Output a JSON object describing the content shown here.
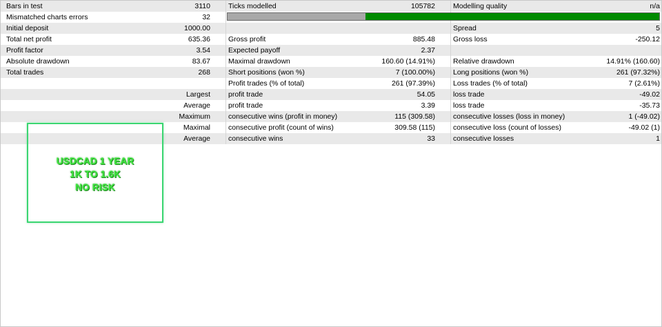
{
  "report": {
    "rows": [
      {
        "shade": true,
        "cells": [
          "Bars in test",
          "",
          "3110",
          "Ticks modelled",
          "105782",
          "Modelling quality",
          "n/a"
        ]
      },
      {
        "shade": false,
        "cells": [
          "Mismatched charts errors",
          "",
          "32",
          "",
          "",
          "",
          ""
        ]
      },
      {
        "shade": true,
        "cells": [
          "Initial deposit",
          "",
          "1000.00",
          "",
          "",
          "Spread",
          "5"
        ]
      },
      {
        "shade": false,
        "cells": [
          "Total net profit",
          "",
          "635.36",
          "Gross profit",
          "885.48",
          "Gross loss",
          "-250.12"
        ]
      },
      {
        "shade": true,
        "cells": [
          "Profit factor",
          "",
          "3.54",
          "Expected payoff",
          "2.37",
          "",
          ""
        ]
      },
      {
        "shade": false,
        "cells": [
          "Absolute drawdown",
          "",
          "83.67",
          "Maximal drawdown",
          "160.60 (14.91%)",
          "Relative drawdown",
          "14.91% (160.60)"
        ]
      },
      {
        "shade": true,
        "cells": [
          "Total trades",
          "",
          "268",
          "Short positions (won %)",
          "7 (100.00%)",
          "Long positions (won %)",
          "261 (97.32%)"
        ]
      },
      {
        "shade": false,
        "cells": [
          "",
          "",
          "",
          "Profit trades (% of total)",
          "261 (97.39%)",
          "Loss trades (% of total)",
          "7 (2.61%)"
        ]
      },
      {
        "shade": true,
        "cells": [
          "",
          "Largest",
          "",
          "profit trade",
          "54.05",
          "loss trade",
          "-49.02"
        ]
      },
      {
        "shade": false,
        "cells": [
          "",
          "Average",
          "",
          "profit trade",
          "3.39",
          "loss trade",
          "-35.73"
        ]
      },
      {
        "shade": true,
        "cells": [
          "",
          "Maximum",
          "",
          "consecutive wins (profit in money)",
          "115 (309.58)",
          "consecutive losses (loss in money)",
          "1 (-49.02)"
        ]
      },
      {
        "shade": false,
        "cells": [
          "",
          "Maximal",
          "",
          "consecutive profit (count of wins)",
          "309.58 (115)",
          "consecutive loss (count of losses)",
          "-49.02 (1)"
        ]
      },
      {
        "shade": true,
        "cells": [
          "",
          "Average",
          "",
          "consecutive wins",
          "33",
          "consecutive losses",
          "1"
        ]
      }
    ],
    "quality_bar": {
      "grey_fraction": 0.32,
      "grey_color": "#a8a8a8",
      "green_color": "#008a00"
    }
  },
  "note": {
    "lines": [
      "USDCAD 1 YEAR",
      "1K TO 1.6K",
      "NO RISK"
    ],
    "text_color": "#3ee63e",
    "border_color": "#3ad671"
  }
}
